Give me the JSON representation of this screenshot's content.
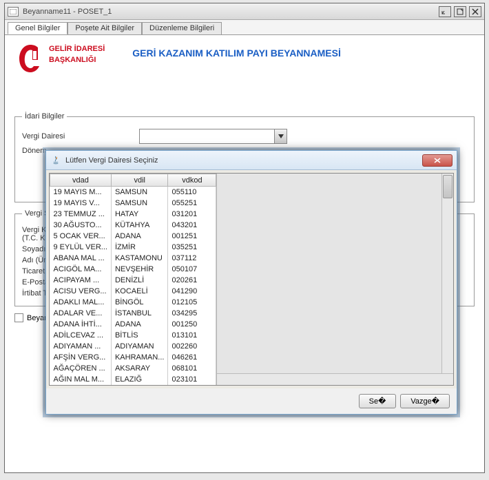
{
  "window": {
    "title": "Beyanname11 - POSET_1"
  },
  "tabs": [
    {
      "label": "Genel Bilgiler",
      "active": true
    },
    {
      "label": "Poşete Ait Bilgiler",
      "active": false
    },
    {
      "label": "Düzenleme Bilgileri",
      "active": false
    }
  ],
  "header": {
    "org_line1": "GELİR İDARESİ",
    "org_line2": "BAŞKANLIĞI",
    "main_title": "GERİ KAZANIM KATILIM PAYI BEYANNAMESİ"
  },
  "idari": {
    "legend": "İdari Bilgiler",
    "vergi_dairesi_label": "Vergi Dairesi",
    "donem_label": "Dönem"
  },
  "vergi_sorumlusu": {
    "legend_partial": "Vergi So",
    "vergi_ki_label": "Vergi Ki",
    "tc_ki_label": "(T.C. Ki",
    "soyadi_label": "Soyadı (",
    "adi_label": "Adı (Ünv",
    "ticaret_label": "Ticaret S",
    "eposta_label": "E-Posta",
    "irtibat_label": "İrtibat T"
  },
  "checkbox": {
    "label_partial": "Beyar"
  },
  "dialog": {
    "title": "Lütfen Vergi Dairesi Seçiniz",
    "columns": {
      "vdad": "vdad",
      "vdil": "vdil",
      "vdkod": "vdkod"
    },
    "rows": [
      {
        "vdad": "19 MAYIS M...",
        "vdil": "SAMSUN",
        "vdkod": "055110"
      },
      {
        "vdad": "19 MAYIS V...",
        "vdil": "SAMSUN",
        "vdkod": "055251"
      },
      {
        "vdad": "23 TEMMUZ ...",
        "vdil": "HATAY",
        "vdkod": "031201"
      },
      {
        "vdad": "30 AĞUSTO...",
        "vdil": "KÜTAHYA",
        "vdkod": "043201"
      },
      {
        "vdad": "5 OCAK VER...",
        "vdil": "ADANA",
        "vdkod": "001251"
      },
      {
        "vdad": "9 EYLÜL VER...",
        "vdil": "İZMİR",
        "vdkod": "035251"
      },
      {
        "vdad": "ABANA MAL ...",
        "vdil": "KASTAMONU",
        "vdkod": "037112"
      },
      {
        "vdad": "ACIGÖL MA...",
        "vdil": "NEVŞEHİR",
        "vdkod": "050107"
      },
      {
        "vdad": "ACIPAYAM ...",
        "vdil": "DENİZLİ",
        "vdkod": "020261"
      },
      {
        "vdad": "ACISU VERG...",
        "vdil": "KOCAELİ",
        "vdkod": "041290"
      },
      {
        "vdad": "ADAKLI MAL...",
        "vdil": "BİNGÖL",
        "vdkod": "012105"
      },
      {
        "vdad": "ADALAR VE...",
        "vdil": "İSTANBUL",
        "vdkod": "034295"
      },
      {
        "vdad": "ADANA İHTİ...",
        "vdil": "ADANA",
        "vdkod": "001250"
      },
      {
        "vdad": "ADİLCEVAZ ...",
        "vdil": "BİTLİS",
        "vdkod": "013101"
      },
      {
        "vdad": "ADIYAMAN ...",
        "vdil": "ADIYAMAN",
        "vdkod": "002260"
      },
      {
        "vdad": "AFŞİN VERG...",
        "vdil": "KAHRAMAN...",
        "vdkod": "046261"
      },
      {
        "vdad": "AĞAÇÖREN ...",
        "vdil": "AKSARAY",
        "vdkod": "068101"
      },
      {
        "vdad": "AĞIN MAL M...",
        "vdil": "ELAZIĞ",
        "vdkod": "023101"
      }
    ],
    "buttons": {
      "select": "Se�",
      "cancel": "Vazge�"
    }
  }
}
